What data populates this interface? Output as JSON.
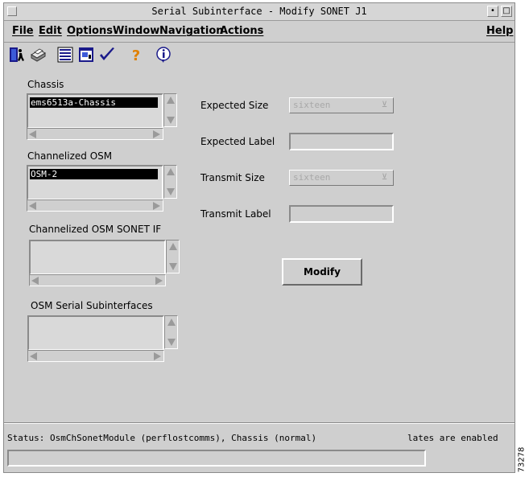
{
  "window": {
    "title": "Serial Subinterface - Modify SONET J1",
    "dot_button": "•",
    "maximize_button": "□"
  },
  "menubar": {
    "file": "File",
    "edit": "Edit",
    "options": "Options",
    "window": "Window",
    "navigation": "Navigation",
    "actions": "Actions",
    "help": "Help"
  },
  "toolbar": {
    "icons": [
      "exit-icon",
      "print-icon",
      "list-icon",
      "window-icon",
      "check-icon",
      "help-icon",
      "info-icon"
    ]
  },
  "left": {
    "chassis_label": "Chassis",
    "chassis_selected": "ems6513a-Chassis",
    "osm_label": "Channelized OSM",
    "osm_selected": "OSM-2",
    "sonet_if_label": "Channelized OSM SONET IF",
    "serial_label": "OSM Serial Subinterfaces"
  },
  "form": {
    "expected_size_label": "Expected Size",
    "expected_size_value": "sixteen",
    "expected_label_label": "Expected Label",
    "expected_label_value": "",
    "transmit_size_label": "Transmit Size",
    "transmit_size_value": "sixteen",
    "transmit_label_label": "Transmit Label",
    "transmit_label_value": "",
    "modify_button": "Modify"
  },
  "status": {
    "text": "Status: OsmChSonetModule (perflostcomms), Chassis (normal)",
    "right_text": "lates are enabled"
  },
  "figure_id": "73278",
  "colors": {
    "window_bg": "#cfcfcf",
    "selection_bg": "#000000",
    "selection_fg": "#ffffff"
  }
}
